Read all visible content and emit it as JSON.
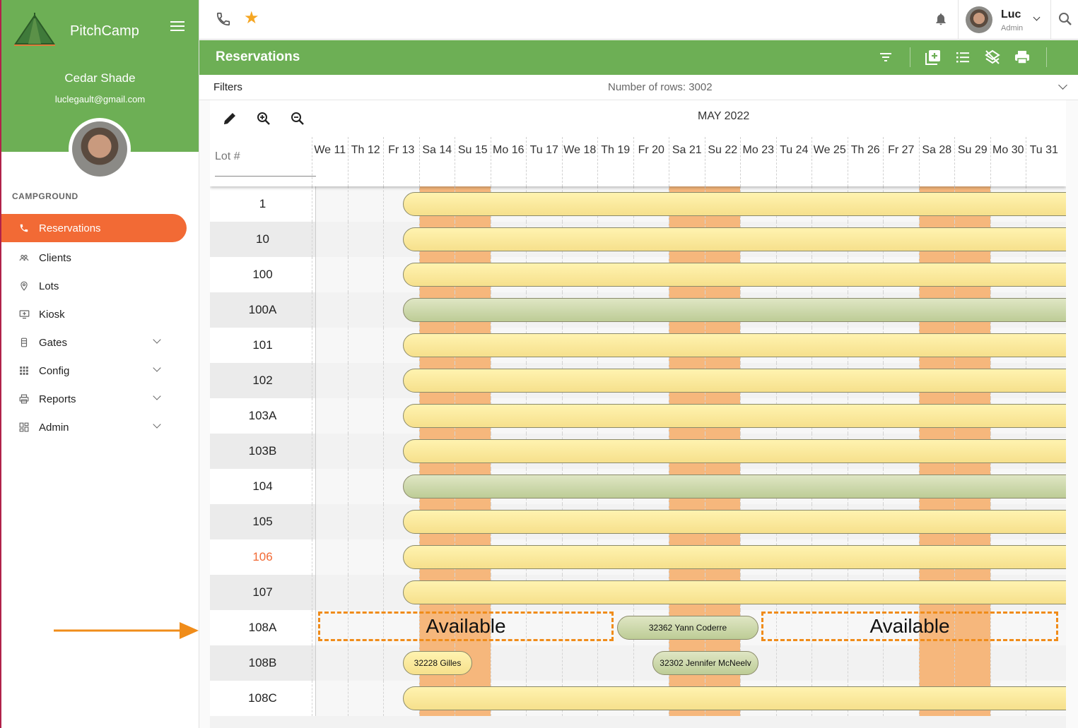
{
  "sidebar": {
    "brand": "PitchCamp",
    "campground_name": "Cedar Shade",
    "email": "luclegault@gmail.com",
    "section_title": "CAMPGROUND",
    "items": [
      {
        "label": "Reservations",
        "icon": "phone-icon",
        "active": true,
        "has_submenu": false
      },
      {
        "label": "Clients",
        "icon": "people-icon",
        "active": false,
        "has_submenu": false
      },
      {
        "label": "Lots",
        "icon": "location-pin-icon",
        "active": false,
        "has_submenu": false
      },
      {
        "label": "Kiosk",
        "icon": "kiosk-icon",
        "active": false,
        "has_submenu": false
      },
      {
        "label": "Gates",
        "icon": "gate-icon",
        "active": false,
        "has_submenu": true
      },
      {
        "label": "Config",
        "icon": "grid-icon",
        "active": false,
        "has_submenu": true
      },
      {
        "label": "Reports",
        "icon": "printer-icon",
        "active": false,
        "has_submenu": true
      },
      {
        "label": "Admin",
        "icon": "dashboard-icon",
        "active": false,
        "has_submenu": true
      }
    ]
  },
  "topbar": {
    "user_name": "Luc",
    "user_role": "Admin"
  },
  "page": {
    "title": "Reservations",
    "filters_label": "Filters",
    "rows_count": "Number of rows: 3002"
  },
  "calendar": {
    "month": "MAY 2022",
    "lot_header": "Lot #",
    "days": [
      "We 11",
      "Th 12",
      "Fr 13",
      "Sa 14",
      "Su 15",
      "Mo 16",
      "Tu 17",
      "We 18",
      "Th 19",
      "Fr 20",
      "Sa 21",
      "Su 22",
      "Mo 23",
      "Tu 24",
      "We 25",
      "Th 26",
      "Fr 27",
      "Sa 28",
      "Su 29",
      "Mo 30",
      "Tu 31"
    ],
    "rows": [
      {
        "lot": "1",
        "status": "yellow"
      },
      {
        "lot": "10",
        "status": "yellow"
      },
      {
        "lot": "100",
        "status": "yellow"
      },
      {
        "lot": "100A",
        "status": "green"
      },
      {
        "lot": "101",
        "status": "yellow"
      },
      {
        "lot": "102",
        "status": "yellow"
      },
      {
        "lot": "103A",
        "status": "yellow"
      },
      {
        "lot": "103B",
        "status": "yellow"
      },
      {
        "lot": "104",
        "status": "green"
      },
      {
        "lot": "105",
        "status": "yellow"
      },
      {
        "lot": "106",
        "status": "yellow",
        "highlight": true
      },
      {
        "lot": "107",
        "status": "yellow"
      },
      {
        "lot": "108A",
        "status": "mixed"
      },
      {
        "lot": "108B",
        "status": "mixed"
      },
      {
        "lot": "108C",
        "status": "yellow"
      }
    ],
    "available_label": "Available",
    "reservation_108a": "32362 Yann Coderre",
    "reservation_108b_1": "32228 Gilles",
    "reservation_108b_2": "32302 Jennifer McNeelv"
  },
  "colors": {
    "brand_green": "#6daf55",
    "accent_orange": "#f26a35",
    "weekend": "#f6b77c",
    "pill_yellow": "#f6e08c",
    "pill_green": "#bdcc96",
    "available_outline": "#f08c1a"
  }
}
